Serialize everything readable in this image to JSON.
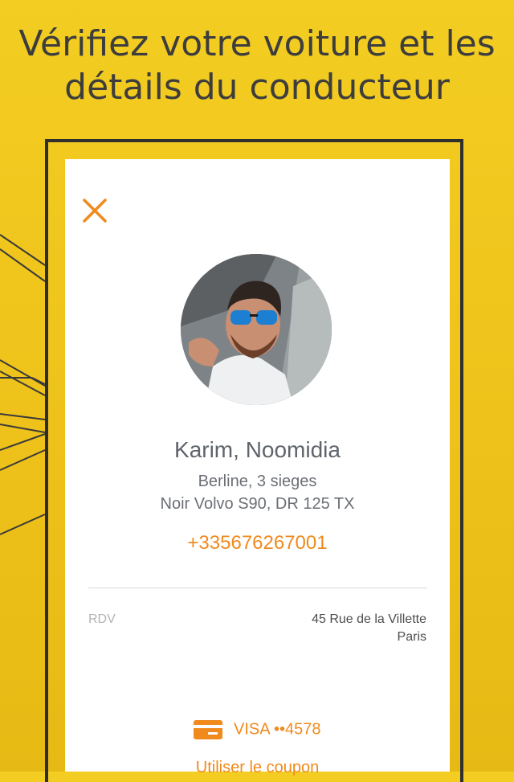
{
  "headline": {
    "line1": "Vérifiez votre voiture et les",
    "line2": "détails du conducteur"
  },
  "driver": {
    "name": "Karim, Noomidia",
    "car_type": "Berline, 3 sieges",
    "car_details": "Noir Volvo S90, DR 125 TX",
    "phone": "+335676267001"
  },
  "meeting": {
    "label": "RDV",
    "address_line1": "45 Rue de la Villette",
    "address_line2": "Paris"
  },
  "payment": {
    "method": "VISA ••4578",
    "coupon": "Utiliser le coupon"
  },
  "colors": {
    "background": "#f2cb20",
    "accent": "#f08a1c",
    "frame": "#2f2f2f"
  },
  "icons": {
    "close": "close-icon",
    "card": "credit-card-icon"
  }
}
